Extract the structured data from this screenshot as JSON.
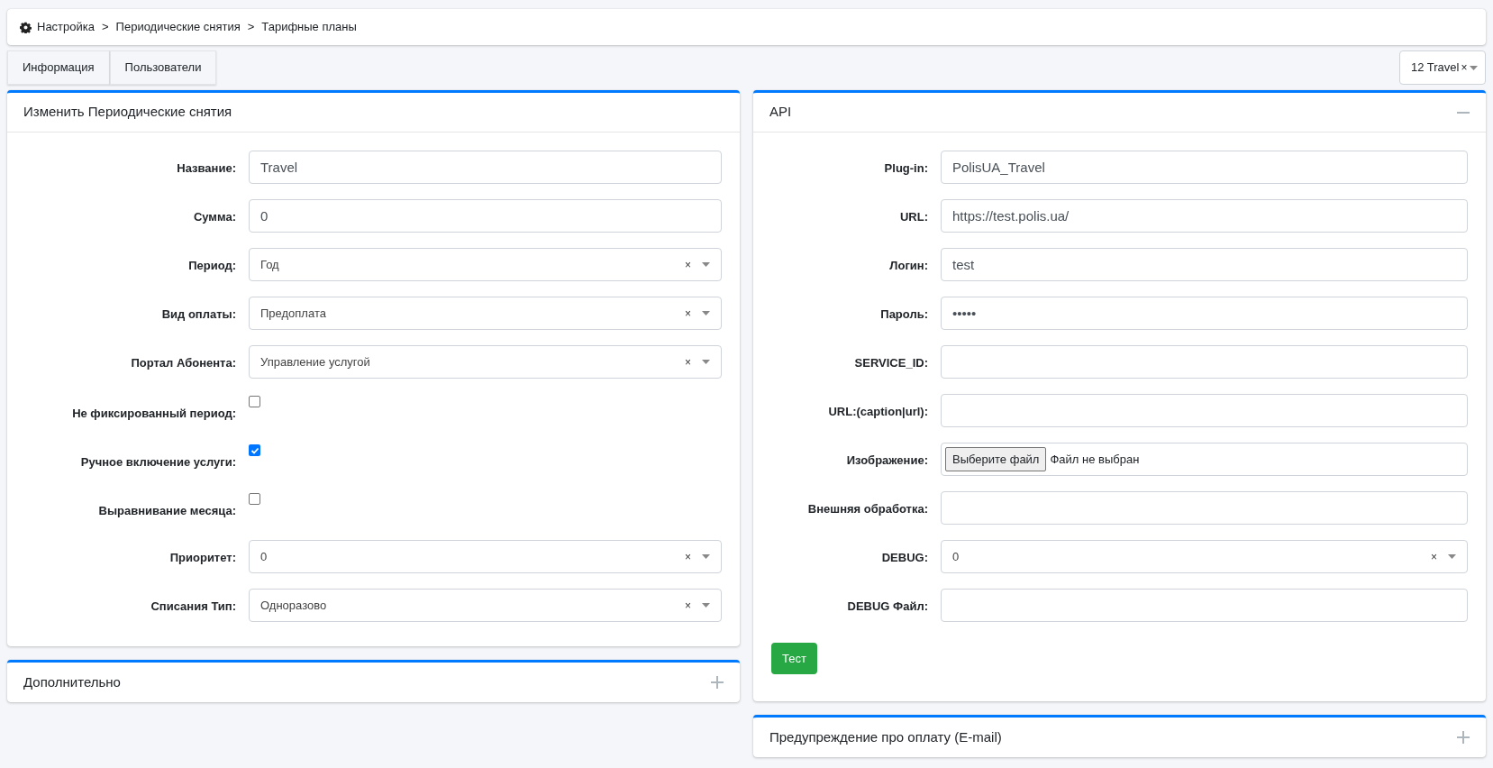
{
  "breadcrumb": [
    "Настройка",
    "Периодические снятия",
    "Тарифные планы"
  ],
  "breadcrumb_separator": ">",
  "tabs": [
    {
      "label": "Информация",
      "selected": false
    },
    {
      "label": "Пользователи",
      "selected": false
    }
  ],
  "selector": {
    "value": "12 Travel",
    "clear": "×"
  },
  "left": {
    "cards": [
      {
        "kind": "form",
        "title": "Изменить Периодические снятия",
        "fields": [
          {
            "kind": "text",
            "label": "Название:",
            "value": "Travel"
          },
          {
            "kind": "text",
            "label": "Сумма:",
            "value": "0"
          },
          {
            "kind": "select",
            "label": "Период:",
            "value": "Год",
            "clear": "×"
          },
          {
            "kind": "select",
            "label": "Вид оплаты:",
            "value": "Предоплата",
            "clear": "×"
          },
          {
            "kind": "select",
            "label": "Портал Абонента:",
            "value": "Управление услугой",
            "clear": "×"
          },
          {
            "kind": "checkbox",
            "label": "Не фиксированный период:",
            "checked": false
          },
          {
            "kind": "checkbox",
            "label": "Ручное включение услуги:",
            "checked": true
          },
          {
            "kind": "checkbox",
            "label": "Выравнивание месяца:",
            "checked": false
          },
          {
            "kind": "select",
            "label": "Приоритет:",
            "value": "0",
            "clear": "×"
          },
          {
            "kind": "select",
            "label": "Списания Тип:",
            "value": "Одноразово",
            "clear": "×"
          }
        ]
      },
      {
        "kind": "collapsible",
        "title": "Дополнительно",
        "expanded": false
      }
    ]
  },
  "right": {
    "cards": [
      {
        "kind": "collapsible",
        "title": "API",
        "expanded": true,
        "fields": [
          {
            "kind": "text",
            "label": "Plug-in:",
            "value": "PolisUA_Travel"
          },
          {
            "kind": "text",
            "label": "URL:",
            "value": "https://test.polis.ua/"
          },
          {
            "kind": "text",
            "label": "Логин:",
            "value": "test"
          },
          {
            "kind": "text",
            "label": "Пароль:",
            "value": "•••••"
          },
          {
            "kind": "text",
            "label": "SERVICE_ID:"
          },
          {
            "kind": "text",
            "label": "URL:(caption|url):"
          },
          {
            "kind": "file",
            "label": "Изображение:",
            "button": "Выберите файл",
            "status": "Файл не выбран"
          },
          {
            "kind": "text",
            "label": "Внешняя обработка:"
          },
          {
            "kind": "select",
            "label": "DEBUG:",
            "value": "0",
            "clear": "×"
          },
          {
            "kind": "text",
            "label": "DEBUG Файл:"
          }
        ],
        "button": "Тест"
      },
      {
        "kind": "collapsible",
        "title": "Предупреждение про оплату (E-mail)",
        "expanded": false
      }
    ]
  }
}
